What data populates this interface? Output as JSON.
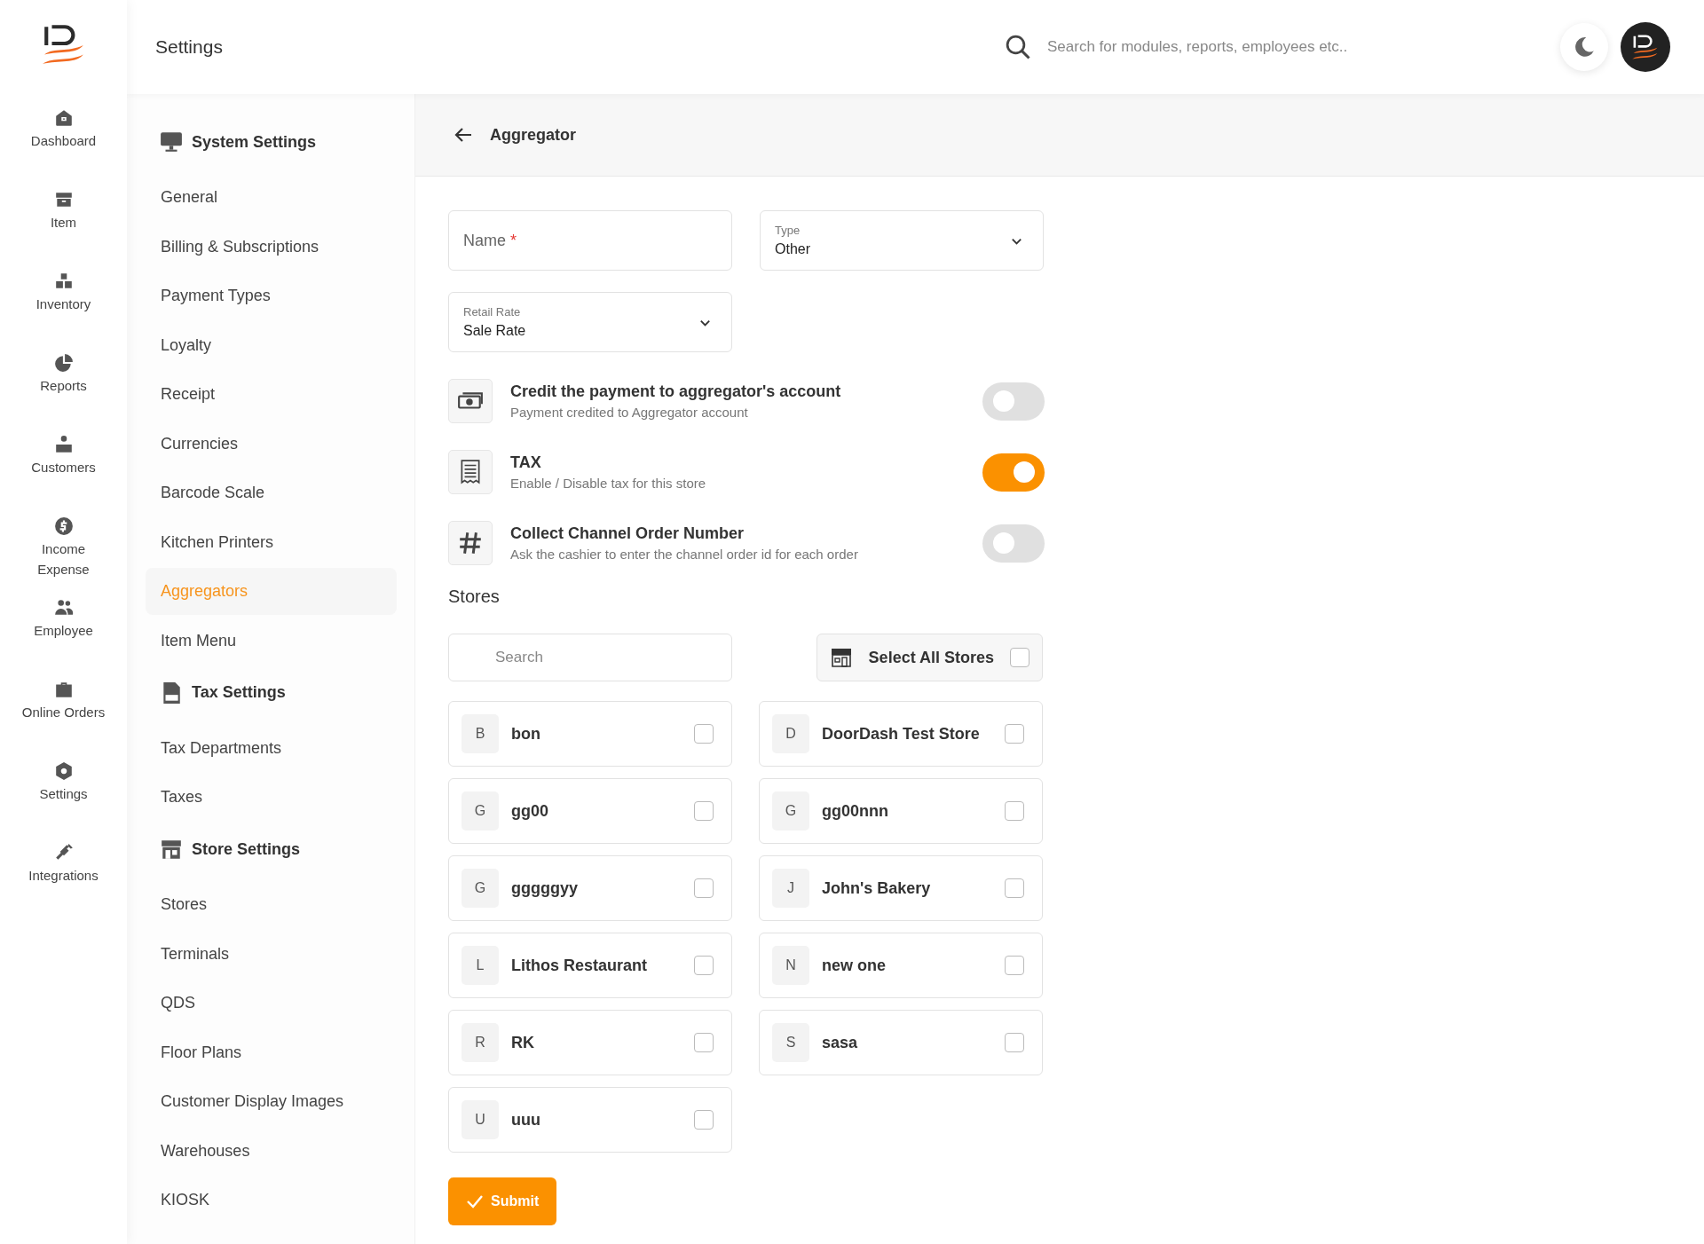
{
  "header": {
    "title": "Settings",
    "search_placeholder": "Search for modules, reports, employees etc.."
  },
  "nav": [
    {
      "label": "Dashboard"
    },
    {
      "label": "Item"
    },
    {
      "label": "Inventory"
    },
    {
      "label": "Reports"
    },
    {
      "label": "Customers"
    },
    {
      "label": "Income Expense"
    },
    {
      "label": "Employee"
    },
    {
      "label": "Online Orders"
    },
    {
      "label": "Settings"
    },
    {
      "label": "Integrations"
    }
  ],
  "settings_menu": [
    {
      "title": "System Settings",
      "items": [
        {
          "label": "General",
          "selected": false
        },
        {
          "label": "Billing & Subscriptions",
          "selected": false
        },
        {
          "label": "Payment Types",
          "selected": false
        },
        {
          "label": "Loyalty",
          "selected": false
        },
        {
          "label": "Receipt",
          "selected": false
        },
        {
          "label": "Currencies",
          "selected": false
        },
        {
          "label": "Barcode Scale",
          "selected": false
        },
        {
          "label": "Kitchen Printers",
          "selected": false
        },
        {
          "label": "Aggregators",
          "selected": true
        },
        {
          "label": "Item Menu",
          "selected": false
        }
      ]
    },
    {
      "title": "Tax Settings",
      "items": [
        {
          "label": "Tax Departments",
          "selected": false
        },
        {
          "label": "Taxes",
          "selected": false
        }
      ]
    },
    {
      "title": "Store Settings",
      "items": [
        {
          "label": "Stores",
          "selected": false
        },
        {
          "label": "Terminals",
          "selected": false
        },
        {
          "label": "QDS",
          "selected": false
        },
        {
          "label": "Floor Plans",
          "selected": false
        },
        {
          "label": "Customer Display Images",
          "selected": false
        },
        {
          "label": "Warehouses",
          "selected": false
        },
        {
          "label": "KIOSK",
          "selected": false
        }
      ]
    }
  ],
  "page": {
    "title": "Aggregator"
  },
  "form": {
    "name": {
      "placeholder": "Name",
      "required_mark": "*"
    },
    "type": {
      "label": "Type",
      "value": "Other"
    },
    "retail_rate": {
      "label": "Retail Rate",
      "value": "Sale Rate"
    }
  },
  "toggles": [
    {
      "title": "Credit the payment to aggregator's account",
      "subtitle": "Payment credited to Aggregator account",
      "on": false
    },
    {
      "title": "TAX",
      "subtitle": "Enable / Disable tax for this store",
      "on": true
    },
    {
      "title": "Collect Channel Order Number",
      "subtitle": "Ask the cashier to enter the channel order id for each order",
      "on": false
    }
  ],
  "stores": {
    "title": "Stores",
    "search_placeholder": "Search",
    "select_all": {
      "label": "Select All Stores",
      "checked": false
    },
    "items": [
      {
        "initial": "B",
        "name": "bon",
        "checked": false
      },
      {
        "initial": "D",
        "name": "DoorDash Test Store",
        "checked": false
      },
      {
        "initial": "G",
        "name": "gg00",
        "checked": false
      },
      {
        "initial": "G",
        "name": "gg00nnn",
        "checked": false
      },
      {
        "initial": "G",
        "name": "gggggyy",
        "checked": false
      },
      {
        "initial": "J",
        "name": "John's Bakery",
        "checked": false
      },
      {
        "initial": "L",
        "name": "Lithos Restaurant",
        "checked": false
      },
      {
        "initial": "N",
        "name": "new one",
        "checked": false
      },
      {
        "initial": "R",
        "name": "RK",
        "checked": false
      },
      {
        "initial": "S",
        "name": "sasa",
        "checked": false
      },
      {
        "initial": "U",
        "name": "uuu",
        "checked": false
      }
    ]
  },
  "submit": {
    "label": "Submit"
  }
}
